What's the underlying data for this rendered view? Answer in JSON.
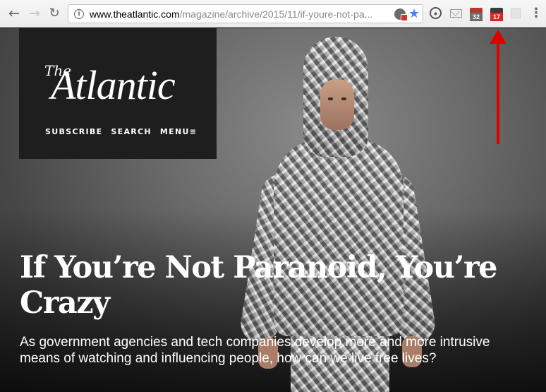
{
  "browser": {
    "url_host": "www.theatlantic.com",
    "url_path": "/magazine/archive/2015/11/if-youre-not-pa...",
    "extensions": {
      "calendar_a_day": "32",
      "calendar_b_day": "17"
    }
  },
  "site": {
    "logo_prefix": "The",
    "logo_name": "Atlantic",
    "nav": {
      "subscribe": "SUBSCRIBE",
      "search": "SEARCH",
      "menu": "MENU≡"
    }
  },
  "article": {
    "headline": "If You’re Not Paranoid, You’re Crazy",
    "dek": "As government agencies and tech companies develop more and more intrusive means of watching and influencing people, how can we live free lives?"
  },
  "annotation": {
    "arrow_color": "#e00000"
  }
}
